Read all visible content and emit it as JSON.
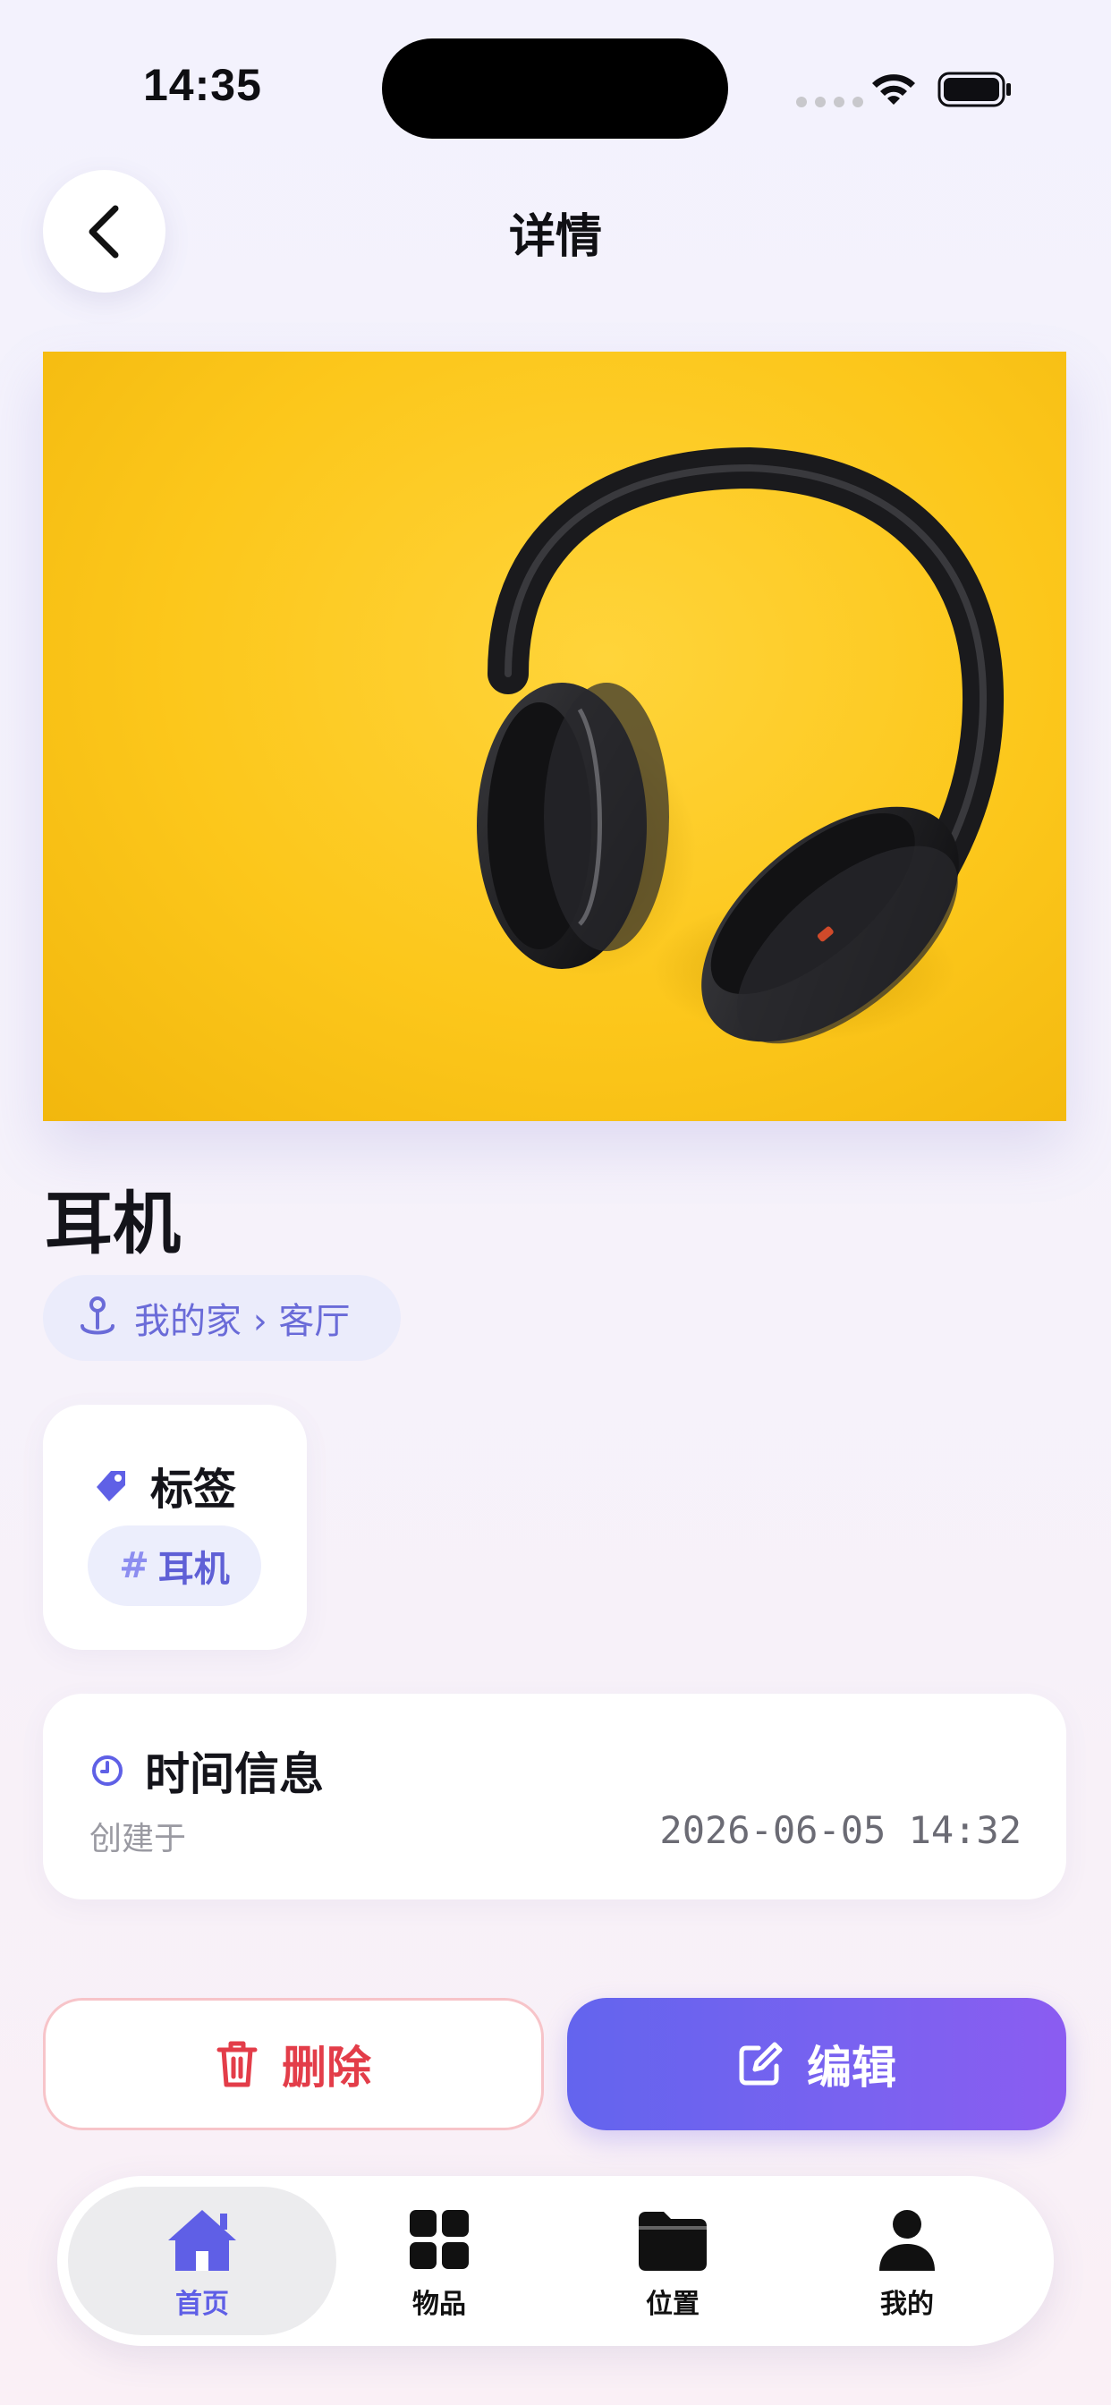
{
  "status_bar": {
    "time": "14:35"
  },
  "header": {
    "title": "详情"
  },
  "item": {
    "name": "耳机",
    "location_path": "我的家 › 客厅"
  },
  "tags": {
    "title": "标签",
    "items": [
      {
        "hash": "#",
        "label": "耳机"
      }
    ]
  },
  "time_info": {
    "title": "时间信息",
    "created_label": "创建于",
    "created_value": "2026-06-05 14:32"
  },
  "actions": {
    "delete_label": "删除",
    "edit_label": "编辑"
  },
  "bottom_nav": {
    "items": [
      {
        "label": "首页",
        "icon": "home-icon",
        "active": true
      },
      {
        "label": "物品",
        "icon": "grid-icon",
        "active": false
      },
      {
        "label": "位置",
        "icon": "folder-icon",
        "active": false
      },
      {
        "label": "我的",
        "icon": "person-icon",
        "active": false
      }
    ]
  },
  "colors": {
    "accent": "#6364EE",
    "danger": "#E33D49",
    "hero_background": "#FCC71B"
  }
}
